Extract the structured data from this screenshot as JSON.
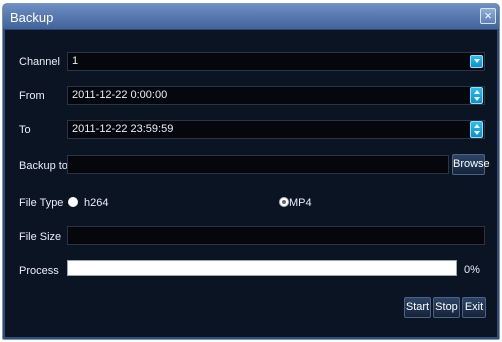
{
  "window": {
    "title": "Backup",
    "close_label": "×"
  },
  "labels": {
    "channel": "Channel",
    "from": "From",
    "to": "To",
    "backup_to": "Backup to",
    "file_type": "File Type",
    "file_size": "File Size",
    "process": "Process"
  },
  "fields": {
    "channel_value": "1",
    "from_value": "2011-12-22 0:00:00",
    "to_value": "2011-12-22 23:59:59",
    "backup_to_value": "",
    "file_size_value": ""
  },
  "file_type": {
    "options": [
      "h264",
      "MP4"
    ],
    "selected": "MP4"
  },
  "progress": {
    "percent": 0,
    "percent_label": "0%"
  },
  "buttons": {
    "browse": "Browse",
    "start": "Start",
    "stop": "Stop",
    "exit": "Exit"
  },
  "colors": {
    "title_bar": "#5475ad",
    "dialog_bg": "#0b1423",
    "spin_button": "#1aa8df"
  }
}
